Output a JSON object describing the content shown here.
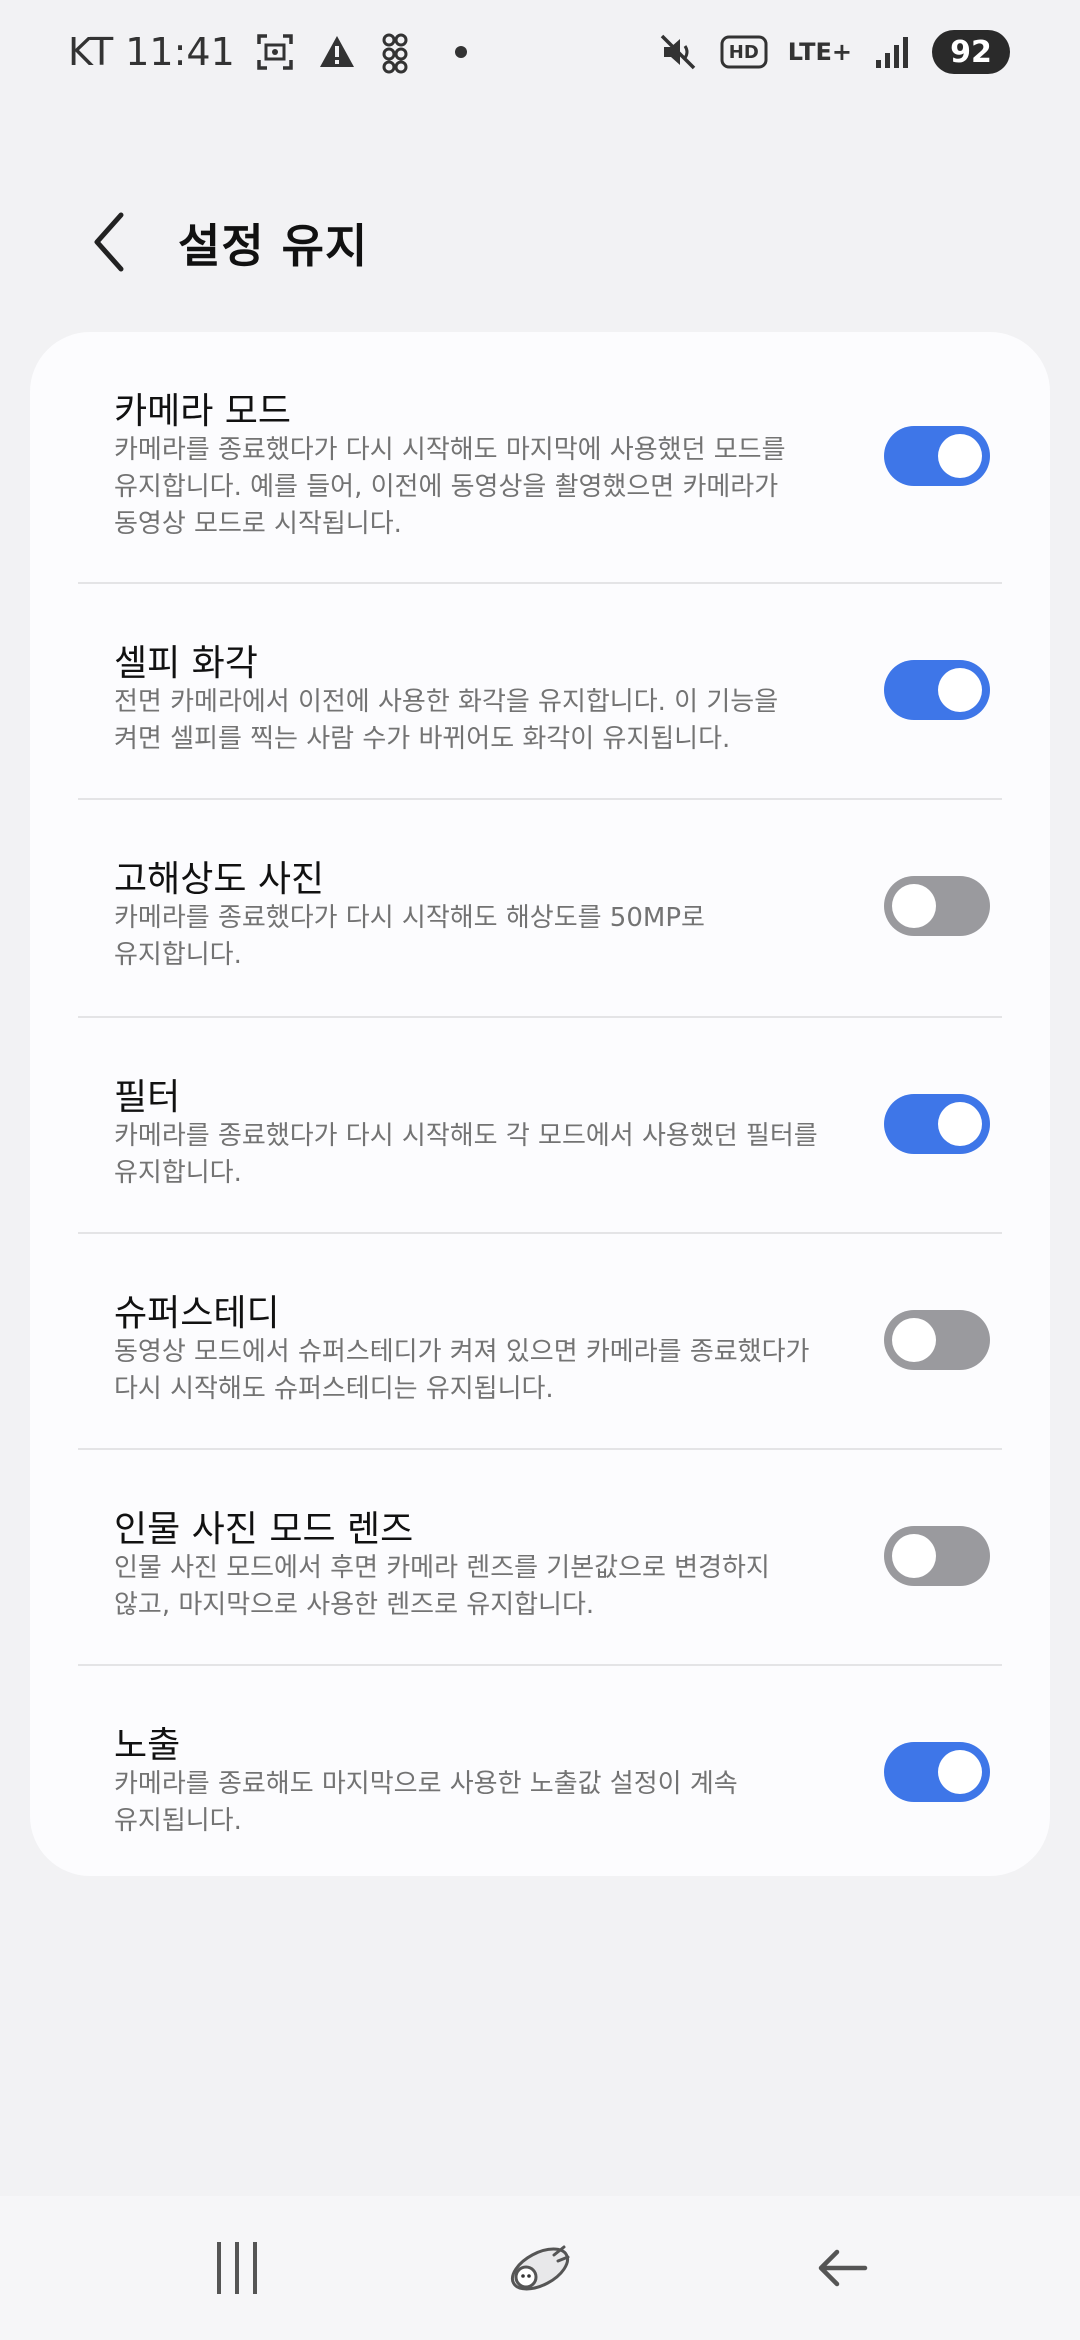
{
  "status_bar": {
    "carrier_time": "KT 11:41",
    "network": "LTE+",
    "hd_badge": "HD",
    "battery": "92"
  },
  "header": {
    "title": "설정 유지"
  },
  "settings": [
    {
      "title": "카메라 모드",
      "desc_lines": [
        "카메라를 종료했다가 다시 시작해도 마지막에 사용했던 모드를",
        "유지합니다. 예를 들어, 이전에 동영상을 촬영했으면 카메라가",
        "동영상 모드로 시작됩니다."
      ],
      "enabled": true
    },
    {
      "title": "셀피 화각",
      "desc_lines": [
        "전면 카메라에서 이전에 사용한 화각을 유지합니다. 이 기능을",
        "켜면 셀피를 찍는 사람 수가 바뀌어도 화각이 유지됩니다."
      ],
      "enabled": true
    },
    {
      "title": "고해상도 사진",
      "desc_lines": [
        "카메라를 종료했다가 다시 시작해도 해상도를 50MP로",
        "유지합니다."
      ],
      "enabled": false
    },
    {
      "title": "필터",
      "desc_lines": [
        "카메라를 종료했다가 다시 시작해도 각 모드에서 사용했던 필터를",
        "유지합니다."
      ],
      "enabled": true
    },
    {
      "title": "슈퍼스테디",
      "desc_lines": [
        "동영상 모드에서 슈퍼스테디가 켜져 있으면 카메라를 종료했다가",
        "다시 시작해도 슈퍼스테디는 유지됩니다."
      ],
      "enabled": false
    },
    {
      "title": "인물 사진 모드 렌즈",
      "desc_lines": [
        "인물 사진 모드에서 후면 카메라 렌즈를 기본값으로 변경하지",
        "않고, 마지막으로 사용한 렌즈로 유지합니다."
      ],
      "enabled": false
    },
    {
      "title": "노출",
      "desc_lines": [
        "카메라를 종료해도 마지막으로 사용한 노출값 설정이 계속",
        "유지됩니다."
      ],
      "enabled": true
    }
  ],
  "colors": {
    "toggle_on": "#3e76e8",
    "toggle_off": "#9a9a9e"
  },
  "nav": {
    "recents": "recents-icon",
    "home": "home-icon",
    "back": "back-arrow-icon"
  }
}
